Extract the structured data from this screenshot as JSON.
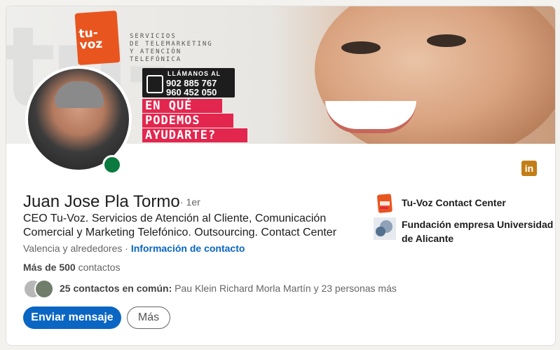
{
  "banner": {
    "logo_text": "tu-voz",
    "tagline": [
      "SERVICIOS",
      "DE TELEMARKETING",
      "Y ATENCIÓN",
      "TELEFÓNICA"
    ],
    "call_label": "LLÁMANOS AL",
    "phones": [
      "902 885 767",
      "960 452 050"
    ],
    "slogan": [
      "EN QUÉ",
      "PODEMOS",
      "AYUDARTE?"
    ]
  },
  "profile": {
    "name": "Juan Jose Pla Tormo",
    "degree": "· 1er",
    "headline": "CEO Tu-Voz. Servicios de Atención al Cliente, Comunicación Comercial y Marketing Telefónico. Outsourcing. Contact Center",
    "location": "Valencia y alrededores",
    "location_sep": " · ",
    "contact_info_link": "Información de contacto",
    "connections_count": "Más de 500",
    "connections_label": " contactos",
    "mutual_count": "25 contactos en común:",
    "mutual_names": " Pau Klein Richard Morla Martín y 23 personas más"
  },
  "actions": {
    "message_label": "Enviar mensaje",
    "more_label": "Más"
  },
  "orgs": [
    {
      "name": "Tu-Voz Contact Center",
      "logo_text": "tu voz"
    },
    {
      "name": "Fundación empresa Universidad de Alicante"
    }
  ],
  "icons": {
    "linkedin": "in"
  },
  "colors": {
    "accent": "#0a66c2",
    "online": "#0b7a3e",
    "banner_red": "#e2264e",
    "logo_orange": "#e8551f",
    "linkedin_icon": "#c37d16"
  }
}
